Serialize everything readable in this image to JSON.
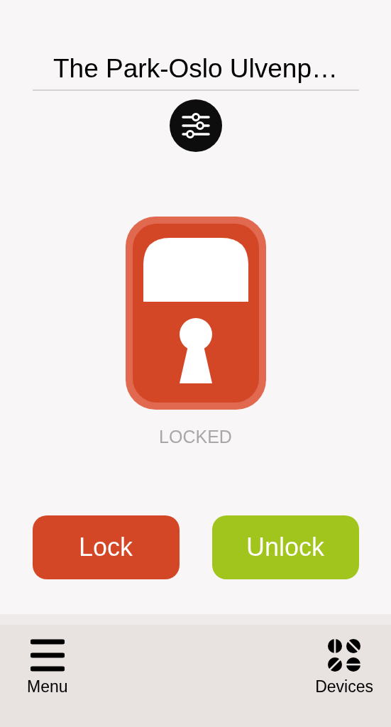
{
  "title": "The Park-Oslo Ulvenp…",
  "lock": {
    "locked": true,
    "status": "LOCKED"
  },
  "buttons": [
    {
      "label": "Lock",
      "color": "#d34726"
    },
    {
      "label": "Unlock",
      "color": "#a2c51e"
    }
  ],
  "nav": [
    {
      "kind": "menu",
      "label": "Menu"
    },
    {
      "kind": "devices",
      "label": "Devices"
    }
  ]
}
